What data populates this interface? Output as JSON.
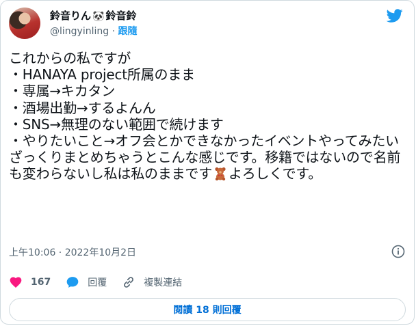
{
  "author": {
    "display_name_part1": "鈴音りん",
    "panda": "🐼",
    "display_name_part2": "鈴音鈴",
    "handle": "@lingyinling",
    "separator": "·",
    "follow_label": "跟隨"
  },
  "tweet": {
    "text_main": "これからの私ですが\n・HANAYA project所属のまま\n・専属→キカタン\n・酒場出勤→するよんん\n・SNS→無理のない範囲で続けます\n・やりたいこと→オフ会とかできなかったイベントやってみたい\nざっくりまとめちゃうとこんな感じです。移籍ではないので名前も変わらないし私は私のままです",
    "text_tail": "よろしくです。",
    "timestamp": "上午10:06 · 2022年10月2日"
  },
  "actions": {
    "likes": "167",
    "reply_label": "回覆",
    "copy_link_label": "複製連結"
  },
  "replies_button": "閱讀 18 則回覆",
  "colors": {
    "accent": "#1d9bf0",
    "heart": "#f91880",
    "text": "#0f1419",
    "muted": "#536471",
    "border": "#cfd9de"
  }
}
